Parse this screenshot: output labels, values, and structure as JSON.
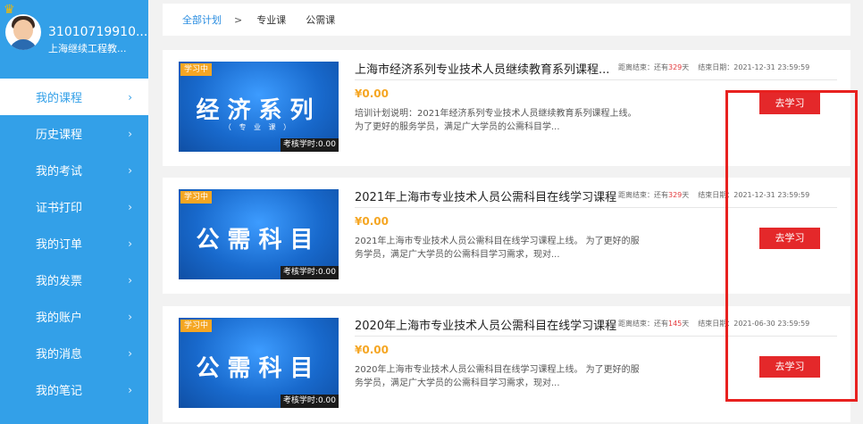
{
  "user": {
    "id": "31010719910...",
    "org": "上海继续工程教..."
  },
  "nav": [
    {
      "label": "我的课程",
      "active": true
    },
    {
      "label": "历史课程"
    },
    {
      "label": "我的考试"
    },
    {
      "label": "证书打印"
    },
    {
      "label": "我的订单"
    },
    {
      "label": "我的发票"
    },
    {
      "label": "我的账户"
    },
    {
      "label": "我的消息"
    },
    {
      "label": "我的笔记"
    }
  ],
  "chevron": "›",
  "breadcrumb": {
    "root": "全部计划",
    "sep": ">",
    "items": [
      "专业课",
      "公需课"
    ]
  },
  "courses": [
    {
      "tag": "学习中",
      "thumb_text": "经济系列",
      "thumb_sub": "（ 专 业 课 ）",
      "hours": "考核学时:0.00",
      "title": "上海市经济系列专业技术人员继续教育系列课程...",
      "remain_label": "距离结束：还有",
      "remain_days": "329",
      "remain_unit": "天",
      "end_label": "结束日期：2021-12-31 23:59:59",
      "price": "¥0.00",
      "desc": "培训计划说明：2021年经济系列专业技术人员继续教育系列课程上线。 为了更好的服务学员，满足广大学员的公需科目学...",
      "button": "去学习"
    },
    {
      "tag": "学习中",
      "thumb_text": "公需科目",
      "thumb_sub": "",
      "hours": "考核学时:0.00",
      "title": "2021年上海市专业技术人员公需科目在线学习课程",
      "remain_label": "距离结束：还有",
      "remain_days": "329",
      "remain_unit": "天",
      "end_label": "结束日期：2021-12-31 23:59:59",
      "price": "¥0.00",
      "desc": "2021年上海市专业技术人员公需科目在线学习课程上线。 为了更好的服务学员，满足广大学员的公需科目学习需求，现对...",
      "button": "去学习"
    },
    {
      "tag": "学习中",
      "thumb_text": "公需科目",
      "thumb_sub": "",
      "hours": "考核学时:0.00",
      "title": "2020年上海市专业技术人员公需科目在线学习课程",
      "remain_label": "距离结束：还有",
      "remain_days": "145",
      "remain_unit": "天",
      "end_label": "结束日期：2021-06-30 23:59:59",
      "price": "¥0.00",
      "desc": "2020年上海市专业技术人员公需科目在线学习课程上线。 为了更好的服务学员，满足广大学员的公需科目学习需求，现对...",
      "button": "去学习"
    }
  ],
  "colors": {
    "sidebar": "#33a0e8",
    "button": "#e4282a",
    "price": "#f5a623",
    "highlight": "#e8211f"
  }
}
